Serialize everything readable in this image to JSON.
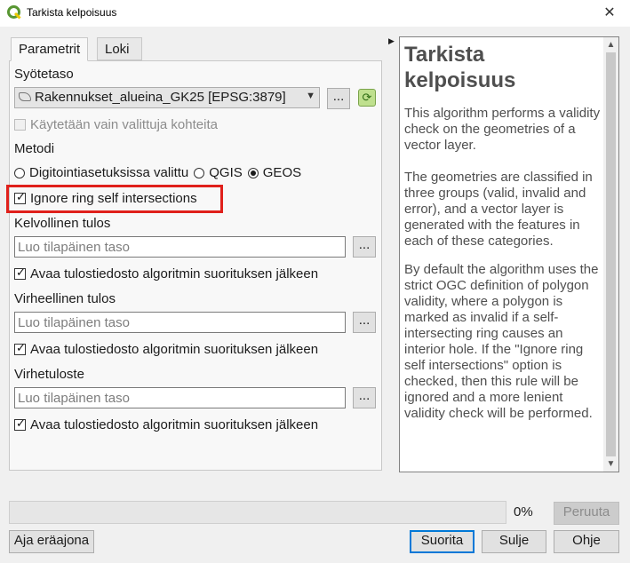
{
  "window": {
    "title": "Tarkista kelpoisuus",
    "close": "✕"
  },
  "tabs": [
    {
      "label": "Parametrit"
    },
    {
      "label": "Loki"
    }
  ],
  "params": {
    "input_layer_label": "Syötetaso",
    "input_layer_value": "Rakennukset_alueina_GK25 [EPSG:3879]",
    "selected_only_label": "Käytetään vain valittuja kohteita",
    "method_label": "Metodi",
    "method_options": [
      "Digitointiasetuksissa valittu",
      "QGIS",
      "GEOS"
    ],
    "method_selected": "GEOS",
    "ignore_ring_label": "Ignore ring self intersections",
    "valid_output_label": "Kelvollinen tulos",
    "invalid_output_label": "Virheellinen tulos",
    "error_output_label": "Virhetuloste",
    "output_placeholder": "Luo tilapäinen taso",
    "open_after_label": "Avaa tulostiedosto algoritmin suorituksen jälkeen",
    "browse": "..."
  },
  "help": {
    "title": "Tarkista kelpoisuus",
    "paragraphs": [
      "This algorithm performs a validity check on the geometries of a vector layer.",
      "The geometries are classified in three groups (valid, invalid and error), and a vector layer is generated with the features in each of these categories.",
      "By default the algorithm uses the strict OGC definition of polygon validity, where a polygon is marked as invalid if a self-intersecting ring causes an interior hole. If the \"Ignore ring self intersections\" option is checked, then this rule will be ignored and a more lenient validity check will be performed."
    ]
  },
  "footer": {
    "progress_text": "0%",
    "progress_fraction": 0,
    "cancel": "Peruuta",
    "batch": "Aja eräajona",
    "run": "Suorita",
    "close": "Sulje",
    "help": "Ohje"
  },
  "colors": {
    "highlight": "#e0201b",
    "qgis_green": "#589632",
    "default_button": "#0078d7"
  }
}
